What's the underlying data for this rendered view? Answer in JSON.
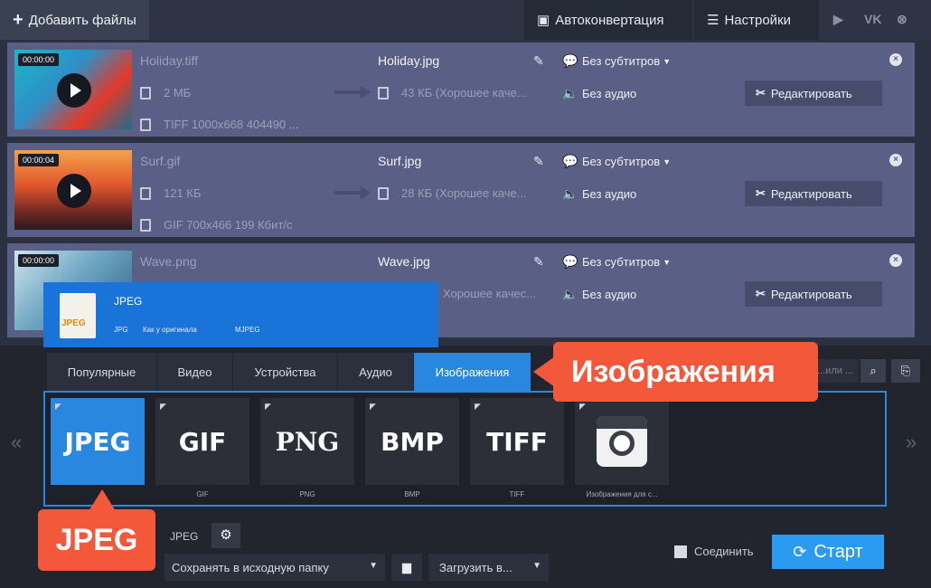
{
  "toolbar": {
    "add_files": "Добавить файлы",
    "autoconvert": "Автоконвертация",
    "settings": "Настройки",
    "social": [
      "▶",
      "VK",
      "⊗"
    ]
  },
  "files": [
    {
      "duration": "00:00:00",
      "src_name": "Holiday.tiff",
      "src_size": "2 МБ",
      "src_info": "TIFF 1000x668 404490 ...",
      "dst_name": "Holiday.jpg",
      "dst_size": "43 КБ (Хорошее каче...",
      "subtitles": "Без субтитров",
      "audio": "Без аудио",
      "edit": "Редактировать"
    },
    {
      "duration": "00:00:04",
      "src_name": "Surf.gif",
      "src_size": "121 КБ",
      "src_info": "GIF 700x466 199 Кбит/с",
      "dst_name": "Surf.jpg",
      "dst_size": "28 КБ (Хорошее каче...",
      "subtitles": "Без субтитров",
      "audio": "Без аудио",
      "edit": "Редактировать"
    },
    {
      "duration": "00:00:00",
      "src_name": "Wave.png",
      "src_size": "",
      "src_info": "",
      "dst_name": "Wave.jpg",
      "dst_size": "Хорошее качес...",
      "subtitles": "Без субтитров",
      "audio": "Без аудио",
      "edit": "Редактировать"
    }
  ],
  "preset_card": {
    "icon_text": "JPEG",
    "title": "JPEG",
    "meta": [
      "JPG",
      "Как у оригинала",
      "MJPEG"
    ]
  },
  "tabs": [
    "Популярные",
    "Видео",
    "Устройства",
    "Аудио",
    "Изображения"
  ],
  "active_tab": "Изображения",
  "search": {
    "placeholder": "...или ..."
  },
  "formats": [
    {
      "label": "JPEG",
      "caption": ""
    },
    {
      "label": "GIF",
      "caption": "GIF"
    },
    {
      "label": "PNG",
      "caption": "PNG"
    },
    {
      "label": "BMP",
      "caption": "BMP"
    },
    {
      "label": "TIFF",
      "caption": "TIFF"
    },
    {
      "label": "",
      "caption": "Изображения для с..."
    }
  ],
  "callouts": {
    "tab": "Изображения",
    "format": "JPEG"
  },
  "bottom": {
    "output_format": "JPEG",
    "save_to": "Сохранять в исходную папку",
    "upload": "Загрузить в...",
    "join": "Соединить",
    "start": "Старт"
  },
  "colors": {
    "accent": "#2a87e0",
    "callout": "#f4583a",
    "row_bg": "#5a5f86",
    "start": "#2a9bf0"
  }
}
